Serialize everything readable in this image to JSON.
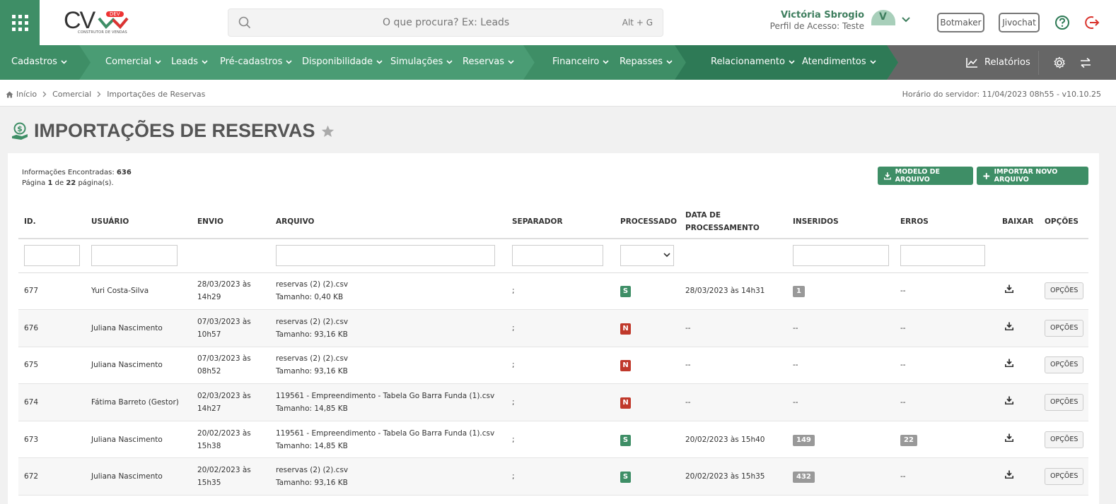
{
  "header": {
    "logo_text": "CV",
    "logo_badge": "DEV",
    "logo_subtitle": "CONSTRUTOR DE VENDAS",
    "search_placeholder": "O que procura? Ex: Leads",
    "search_shortcut": "Alt + G",
    "user_name": "Victória Sbrogio",
    "user_role": "Perfil de Acesso: Teste",
    "avatar_initial": "V",
    "botmaker_label": "Botmaker",
    "jivochat_label": "Jivochat"
  },
  "nav": {
    "items": [
      {
        "label": "Cadastros"
      },
      {
        "label": "Comercial"
      },
      {
        "label": "Leads"
      },
      {
        "label": "Pré-cadastros"
      },
      {
        "label": "Disponibilidade"
      },
      {
        "label": "Simulações"
      },
      {
        "label": "Reservas"
      },
      {
        "label": "Financeiro"
      },
      {
        "label": "Repasses"
      },
      {
        "label": "Relacionamento"
      },
      {
        "label": "Atendimentos"
      }
    ],
    "reports_label": "Relatórios"
  },
  "breadcrumb": {
    "home": "Início",
    "level1": "Comercial",
    "level2": "Importações de Reservas"
  },
  "server_time": "Horário do servidor: 11/04/2023 08h55 - v10.10.25",
  "page": {
    "title": "IMPORTAÇÕES DE RESERVAS",
    "info_found_label": "Informações Encontradas:",
    "info_found_value": "636",
    "page_label": "Página",
    "page_current": "1",
    "page_of": "de",
    "page_total": "22",
    "page_suffix": "página(s).",
    "btn_model": "MODELO DE ARQUIVO",
    "btn_import": "IMPORTAR NOVO ARQUIVO"
  },
  "table": {
    "columns": {
      "id": "ID.",
      "user": "USUÁRIO",
      "sent": "ENVIO",
      "file": "ARQUIVO",
      "separator": "SEPARADOR",
      "processed": "PROCESSADO",
      "processed_date_1": "DATA DE",
      "processed_date_2": "PROCESSAMENTO",
      "inserted": "INSERIDOS",
      "errors": "ERROS",
      "download": "BAIXAR",
      "options": "OPÇÕES"
    },
    "rows": [
      {
        "id": "677",
        "user": "Yuri Costa-Silva",
        "sent_date": "28/03/2023 às",
        "sent_time": "14h29",
        "file": "reservas (2) (2).csv",
        "size": "Tamanho: 0,40 KB",
        "separator": ";",
        "processed": "S",
        "processed_at": "28/03/2023 às 14h31",
        "inserted": "1",
        "errors": "--",
        "options": "OPÇÕES"
      },
      {
        "id": "676",
        "user": "Juliana Nascimento",
        "sent_date": "07/03/2023 às",
        "sent_time": "10h57",
        "file": "reservas (2) (2).csv",
        "size": "Tamanho: 93,16 KB",
        "separator": ";",
        "processed": "N",
        "processed_at": "--",
        "inserted": "--",
        "errors": "--",
        "options": "OPÇÕES"
      },
      {
        "id": "675",
        "user": "Juliana Nascimento",
        "sent_date": "07/03/2023 às",
        "sent_time": "08h52",
        "file": "reservas (2) (2).csv",
        "size": "Tamanho: 93,16 KB",
        "separator": ";",
        "processed": "N",
        "processed_at": "--",
        "inserted": "--",
        "errors": "--",
        "options": "OPÇÕES"
      },
      {
        "id": "674",
        "user": "Fátima Barreto (Gestor)",
        "sent_date": "02/03/2023 às",
        "sent_time": "14h27",
        "file": "119561 - Empreendimento - Tabela Go Barra Funda (1).csv",
        "size": "Tamanho: 14,85 KB",
        "separator": ";",
        "processed": "N",
        "processed_at": "--",
        "inserted": "--",
        "errors": "--",
        "options": "OPÇÕES"
      },
      {
        "id": "673",
        "user": "Juliana Nascimento",
        "sent_date": "20/02/2023 às",
        "sent_time": "15h38",
        "file": "119561 - Empreendimento - Tabela Go Barra Funda (1).csv",
        "size": "Tamanho: 14,85 KB",
        "separator": ";",
        "processed": "S",
        "processed_at": "20/02/2023 às 15h40",
        "inserted": "149",
        "errors": "22",
        "options": "OPÇÕES"
      },
      {
        "id": "672",
        "user": "Juliana Nascimento",
        "sent_date": "20/02/2023 às",
        "sent_time": "15h35",
        "file": "reservas (2) (2).csv",
        "size": "Tamanho: 93,16 KB",
        "separator": ";",
        "processed": "S",
        "processed_at": "20/02/2023 às 15h35",
        "inserted": "432",
        "errors": "--",
        "options": "OPÇÕES"
      }
    ]
  },
  "colors": {
    "brand_green": "#3e8e66",
    "nav_dark": "#2e7a56",
    "nav_gray": "#666666",
    "status_no": "#c0392b",
    "badge_gray": "#999999"
  }
}
